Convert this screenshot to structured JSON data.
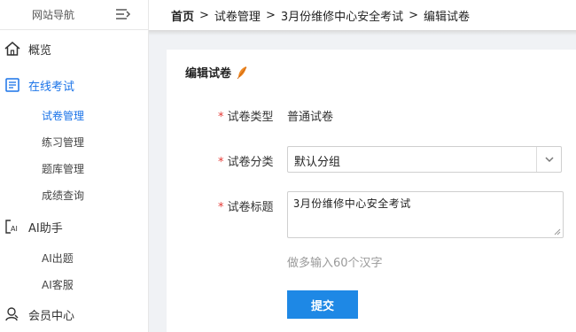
{
  "sidebar": {
    "header_title": "网站导航",
    "nav": {
      "overview": "概览",
      "online_exam": "在线考试",
      "ai_assistant": "AI助手",
      "member_center": "会员中心"
    },
    "exam_sub": [
      "试卷管理",
      "练习管理",
      "题库管理",
      "成绩查询"
    ],
    "ai_sub": [
      "AI出题",
      "AI客服"
    ],
    "active_color": "#1a73e8"
  },
  "breadcrumb": {
    "items": [
      "首页",
      "试卷管理",
      "3月份维修中心安全考试",
      "编辑试卷"
    ],
    "separator": ">"
  },
  "form": {
    "title": "编辑试卷",
    "required_mark": "*",
    "type_label": "试卷类型",
    "type_value": "普通试卷",
    "category_label": "试卷分类",
    "category_value": "默认分组",
    "title_label": "试卷标题",
    "title_value": "3月份维修中心安全考试",
    "hint": "做多输入60个汉字",
    "submit_label": "提交",
    "accent_color": "#1e88e5"
  }
}
